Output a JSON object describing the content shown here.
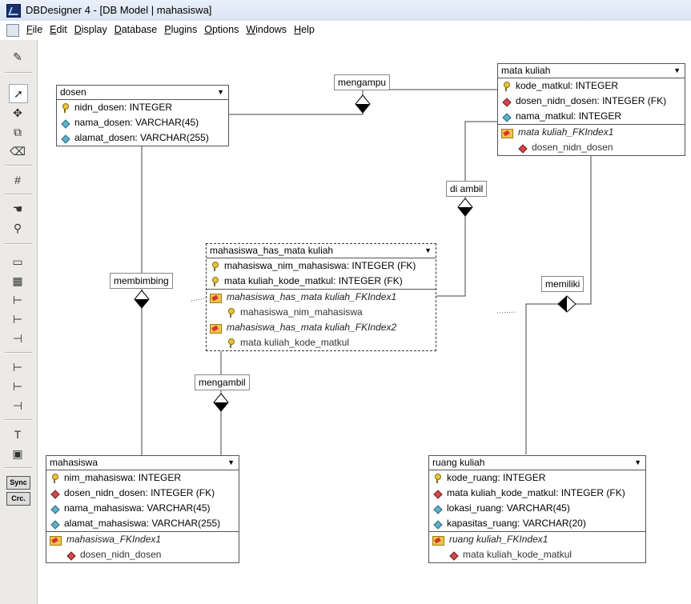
{
  "window": {
    "title": "DBDesigner 4 - [DB Model | mahasiswa]"
  },
  "menu": [
    "File",
    "Edit",
    "Display",
    "Database",
    "Plugins",
    "Options",
    "Windows",
    "Help"
  ],
  "toolbar": {
    "sync_label": "Sync",
    "crc_label": "Crc."
  },
  "tables": {
    "dosen": {
      "name": "dosen",
      "cols": [
        "nidn_dosen: INTEGER",
        "nama_dosen: VARCHAR(45)",
        "alamat_dosen: VARCHAR(255)"
      ]
    },
    "mata_kuliah": {
      "name": "mata kuliah",
      "cols": [
        "kode_matkul: INTEGER",
        "dosen_nidn_dosen: INTEGER (FK)",
        "nama_matkul: INTEGER"
      ],
      "index": "mata kuliah_FKIndex1",
      "index_cols": [
        "dosen_nidn_dosen"
      ]
    },
    "mhmk": {
      "name": "mahasiswa_has_mata kuliah",
      "cols": [
        "mahasiswa_nim_mahasiswa: INTEGER (FK)",
        "mata kuliah_kode_matkul: INTEGER (FK)"
      ],
      "index1": "mahasiswa_has_mata kuliah_FKIndex1",
      "index1_cols": [
        "mahasiswa_nim_mahasiswa"
      ],
      "index2": "mahasiswa_has_mata kuliah_FKIndex2",
      "index2_cols": [
        "mata kuliah_kode_matkul"
      ]
    },
    "mahasiswa": {
      "name": "mahasiswa",
      "cols": [
        "nim_mahasiswa: INTEGER",
        "dosen_nidn_dosen: INTEGER (FK)",
        "nama_mahasiswa: VARCHAR(45)",
        "alamat_mahasiswa: VARCHAR(255)"
      ],
      "index": "mahasiswa_FKIndex1",
      "index_cols": [
        "dosen_nidn_dosen"
      ]
    },
    "ruang_kuliah": {
      "name": "ruang kuliah",
      "cols": [
        "kode_ruang: INTEGER",
        "mata kuliah_kode_matkul: INTEGER (FK)",
        "lokasi_ruang: VARCHAR(45)",
        "kapasitas_ruang: VARCHAR(20)"
      ],
      "index": "ruang kuliah_FKIndex1",
      "index_cols": [
        "mata kuliah_kode_matkul"
      ]
    }
  },
  "relations": {
    "mengampu": "mengampu",
    "di_ambil": "di ambil",
    "membimbing": "membimbing",
    "memiliki": "memiliki",
    "mengambil": "mengambil"
  }
}
